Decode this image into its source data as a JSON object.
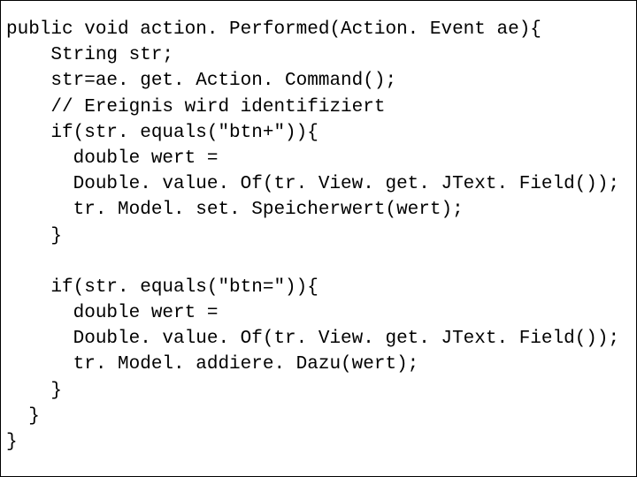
{
  "code": {
    "lines": [
      "public void action. Performed(Action. Event ae){",
      "    String str;",
      "    str=ae. get. Action. Command();",
      "    // Ereignis wird identifiziert",
      "    if(str. equals(\"btn+\")){",
      "      double wert =",
      "      Double. value. Of(tr. View. get. JText. Field());",
      "      tr. Model. set. Speicherwert(wert);",
      "    }",
      "",
      "    if(str. equals(\"btn=\")){",
      "      double wert =",
      "      Double. value. Of(tr. View. get. JText. Field());",
      "      tr. Model. addiere. Dazu(wert);",
      "    }",
      "  }",
      "}"
    ]
  }
}
